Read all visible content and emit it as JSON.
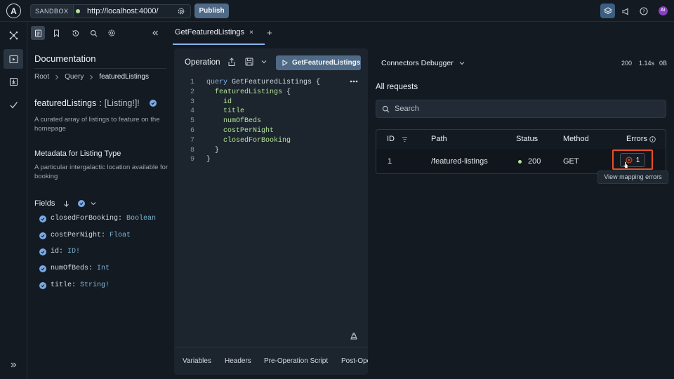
{
  "topbar": {
    "logo_letter": "A",
    "env_badge": "SANDBOX",
    "url": "http://localhost:4000/",
    "publish_label": "Publish",
    "avatar_initials": "AI",
    "icons": [
      "apollo-logo-icon",
      "settings-gear-icon",
      "layers-icon",
      "megaphone-icon",
      "help-icon",
      "avatar"
    ],
    "colors": {
      "accent": "#4f6a86",
      "status_dot": "#b4e29b"
    }
  },
  "rail": {
    "items": [
      "schema-icon",
      "explorer-icon",
      "import-icon",
      "checks-icon",
      "expand-icon"
    ]
  },
  "docs": {
    "title": "Documentation",
    "breadcrumb": [
      "Root",
      "Query",
      "featuredListings"
    ],
    "field_name": "featuredListings",
    "field_type": "[Listing!]!",
    "field_description": "A curated array of listings to feature on the homepage",
    "meta_title": "Metadata for Listing Type",
    "meta_description": "A particular intergalactic location available for booking",
    "fields_label": "Fields",
    "fields": [
      {
        "name": "closedForBooking:",
        "type": "Boolean"
      },
      {
        "name": "costPerNight:",
        "type": "Float"
      },
      {
        "name": "id:",
        "type": "ID!"
      },
      {
        "name": "numOfBeds:",
        "type": "Int"
      },
      {
        "name": "title:",
        "type": "String!"
      }
    ]
  },
  "tabs": {
    "active_tab": "GetFeaturedListings",
    "close_glyph": "×",
    "add_glyph": "+"
  },
  "operation": {
    "label": "Operation",
    "run_label": "GetFeaturedListings",
    "lines": [
      {
        "n": "1",
        "kw": "query",
        "text": " GetFeaturedListings {"
      },
      {
        "n": "2",
        "indent": "  ",
        "field": "featuredListings",
        "text": " {"
      },
      {
        "n": "3",
        "indent": "    ",
        "field": "id",
        "text": ""
      },
      {
        "n": "4",
        "indent": "    ",
        "field": "title",
        "text": ""
      },
      {
        "n": "5",
        "indent": "    ",
        "field": "numOfBeds",
        "text": ""
      },
      {
        "n": "6",
        "indent": "    ",
        "field": "costPerNight",
        "text": ""
      },
      {
        "n": "7",
        "indent": "    ",
        "field": "closedForBooking",
        "text": ""
      },
      {
        "n": "8",
        "indent": "  ",
        "text": "}"
      },
      {
        "n": "9",
        "text": "}"
      }
    ],
    "bottom_tabs": [
      "Variables",
      "Headers",
      "Pre-Operation Script",
      "Post-Ope"
    ]
  },
  "debugger": {
    "title": "Connectors Debugger",
    "stat_status": "200",
    "stat_time": "1.14s",
    "stat_size": "0B",
    "section_title": "All requests",
    "search_placeholder": "Search",
    "columns": [
      "ID",
      "Path",
      "Status",
      "Method",
      "Errors"
    ],
    "rows": [
      {
        "id": "1",
        "path": "/featured-listings",
        "status": "200",
        "method": "GET",
        "errors": "1"
      }
    ],
    "tooltip": "View mapping errors",
    "colors": {
      "error_highlight": "#e8502a",
      "error_icon": "#e8502a"
    }
  }
}
